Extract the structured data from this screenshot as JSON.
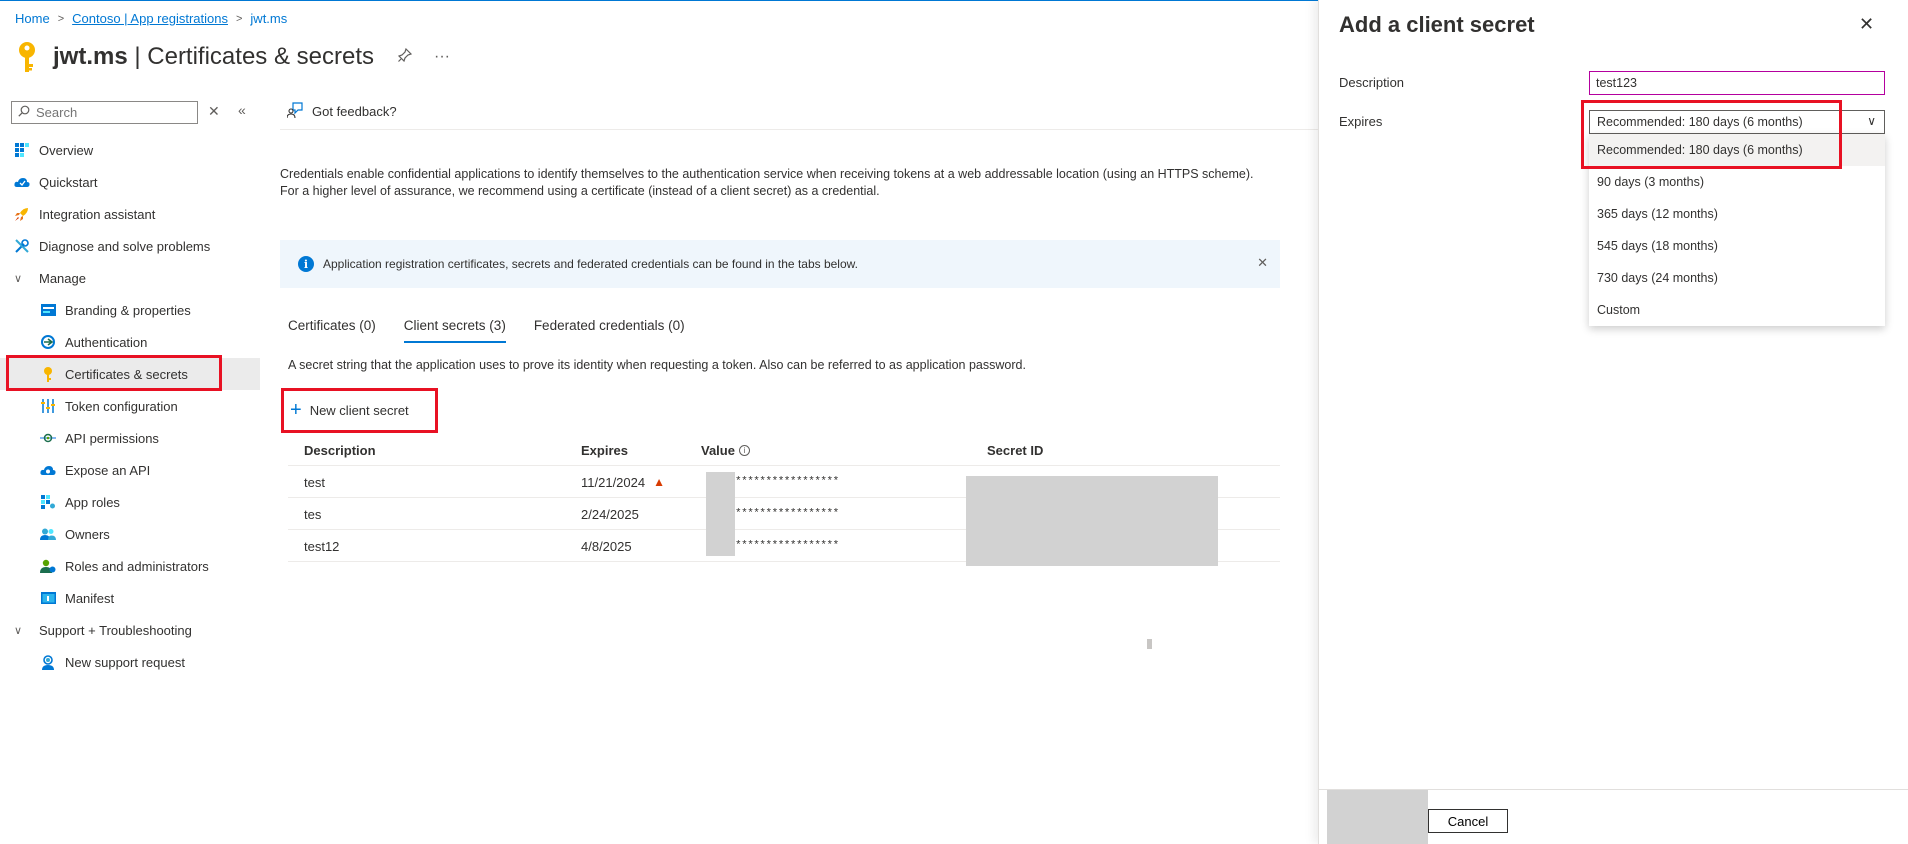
{
  "breadcrumb": {
    "home": "Home",
    "tenant": "Contoso | App registrations",
    "app": "jwt.ms"
  },
  "header": {
    "app_name": "jwt.ms",
    "page_name": "| Certificates & secrets",
    "pin_icon": "pin-icon",
    "more_label": "···"
  },
  "sidebar": {
    "search_placeholder": "Search",
    "items": [
      {
        "label": "Overview",
        "icon": "overview-icon"
      },
      {
        "label": "Quickstart",
        "icon": "quickstart-icon"
      },
      {
        "label": "Integration assistant",
        "icon": "rocket-icon"
      },
      {
        "label": "Diagnose and solve problems",
        "icon": "wrench-icon"
      },
      {
        "label": "Manage",
        "icon": "chevron-down-icon"
      },
      {
        "label": "Branding & properties",
        "icon": "branding-icon"
      },
      {
        "label": "Authentication",
        "icon": "authentication-icon"
      },
      {
        "label": "Certificates & secrets",
        "icon": "key-icon"
      },
      {
        "label": "Token configuration",
        "icon": "token-icon"
      },
      {
        "label": "API permissions",
        "icon": "api-permissions-icon"
      },
      {
        "label": "Expose an API",
        "icon": "cloud-icon"
      },
      {
        "label": "App roles",
        "icon": "app-roles-icon"
      },
      {
        "label": "Owners",
        "icon": "owners-icon"
      },
      {
        "label": "Roles and administrators",
        "icon": "roles-icon"
      },
      {
        "label": "Manifest",
        "icon": "manifest-icon"
      },
      {
        "label": "Support + Troubleshooting",
        "icon": "chevron-down-icon"
      },
      {
        "label": "New support request",
        "icon": "support-icon"
      }
    ]
  },
  "main": {
    "feedback": "Got feedback?",
    "intro": "Credentials enable confidential applications to identify themselves to the authentication service when receiving tokens at a web addressable location (using an HTTPS scheme). For a higher level of assurance, we recommend using a certificate (instead of a client secret) as a credential.",
    "info_bar": "Application registration certificates, secrets and federated credentials can be found in the tabs below.",
    "tabs": [
      {
        "label": "Certificates (0)"
      },
      {
        "label": "Client secrets (3)"
      },
      {
        "label": "Federated credentials (0)"
      }
    ],
    "secret_description": "A secret string that the application uses to prove its identity when requesting a token. Also can be referred to as application password.",
    "new_secret_label": "New client secret",
    "table": {
      "headers": {
        "description": "Description",
        "expires": "Expires",
        "value": "Value",
        "secret_id": "Secret ID"
      },
      "rows": [
        {
          "description": "test",
          "expires": "11/21/2024",
          "value": "*****************",
          "warning": true
        },
        {
          "description": "tes",
          "expires": "2/24/2025",
          "value": "*****************"
        },
        {
          "description": "test12",
          "expires": "4/8/2025",
          "value": "*****************"
        }
      ]
    }
  },
  "panel": {
    "title": "Add a client secret",
    "description_label": "Description",
    "description_value": "test123",
    "expires_label": "Expires",
    "expires_selected": "Recommended: 180 days (6 months)",
    "options": [
      {
        "label": "Recommended: 180 days (6 months)"
      },
      {
        "label": "90 days (3 months)"
      },
      {
        "label": "365 days (12 months)"
      },
      {
        "label": "545 days (18 months)"
      },
      {
        "label": "730 days (24 months)"
      },
      {
        "label": "Custom"
      }
    ],
    "cancel_label": "Cancel"
  },
  "colors": {
    "accent": "#0078d4",
    "highlight_box": "#e81123",
    "warning": "#d83b01",
    "info_bg": "#eff6fc"
  }
}
